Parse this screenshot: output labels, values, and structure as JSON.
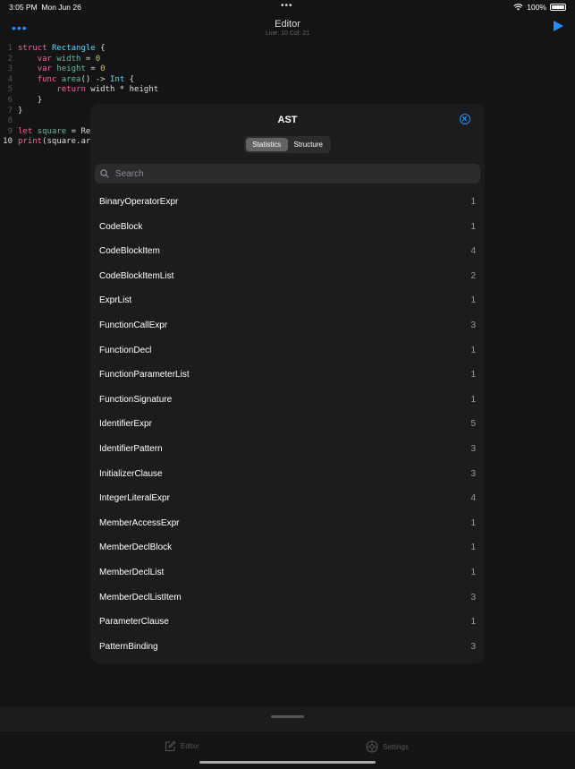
{
  "status_bar": {
    "time": "3:05 PM",
    "date": "Mon Jun 26",
    "battery": "100%"
  },
  "nav": {
    "title": "Editor",
    "subtitle": "Line: 10 Col: 21",
    "more_label": "•••"
  },
  "editor": {
    "line_numbers": [
      "1",
      "2",
      "3",
      "4",
      "5",
      "6",
      "7",
      "8",
      "9",
      "10"
    ],
    "code": {
      "l1_kw": "struct",
      "l1_name": "Rectangle",
      "l1_brace": " {",
      "l2_kw": "var",
      "l2_id": "width",
      "l2_eq": " = ",
      "l2_num": "0",
      "l3_kw": "var",
      "l3_id": "height",
      "l3_eq": " = ",
      "l3_num": "0",
      "l4_kw": "func",
      "l4_id": "area",
      "l4_mid": "() -> ",
      "l4_ty": "Int",
      "l4_end": " {",
      "l5_kw": "return",
      "l5_rest": " width * height",
      "l6": "}",
      "l7": "}",
      "l9_kw": "let",
      "l9_id": "square",
      "l9_rest": " = Re",
      "l10_id": "print",
      "l10_rest": "(square.ar"
    }
  },
  "modal": {
    "title": "AST",
    "tabs": [
      "Statistics",
      "Structure"
    ],
    "search_placeholder": "Search",
    "items": [
      {
        "name": "BinaryOperatorExpr",
        "count": "1"
      },
      {
        "name": "CodeBlock",
        "count": "1"
      },
      {
        "name": "CodeBlockItem",
        "count": "4"
      },
      {
        "name": "CodeBlockItemList",
        "count": "2"
      },
      {
        "name": "ExprList",
        "count": "1"
      },
      {
        "name": "FunctionCallExpr",
        "count": "3"
      },
      {
        "name": "FunctionDecl",
        "count": "1"
      },
      {
        "name": "FunctionParameterList",
        "count": "1"
      },
      {
        "name": "FunctionSignature",
        "count": "1"
      },
      {
        "name": "IdentifierExpr",
        "count": "5"
      },
      {
        "name": "IdentifierPattern",
        "count": "3"
      },
      {
        "name": "InitializerClause",
        "count": "3"
      },
      {
        "name": "IntegerLiteralExpr",
        "count": "4"
      },
      {
        "name": "MemberAccessExpr",
        "count": "1"
      },
      {
        "name": "MemberDeclBlock",
        "count": "1"
      },
      {
        "name": "MemberDeclList",
        "count": "1"
      },
      {
        "name": "MemberDeclListItem",
        "count": "3"
      },
      {
        "name": "ParameterClause",
        "count": "1"
      },
      {
        "name": "PatternBinding",
        "count": "3"
      }
    ]
  },
  "tabbar": {
    "editor_label": "Editor",
    "settings_label": "Settings"
  },
  "colors": {
    "accent": "#1e90ff",
    "background": "#141414",
    "modal": "#1c1c1e"
  },
  "icons": [
    "wifi-icon",
    "battery-icon",
    "more-icon",
    "play-icon",
    "close-icon",
    "search-icon",
    "compose-icon",
    "gear-icon"
  ]
}
